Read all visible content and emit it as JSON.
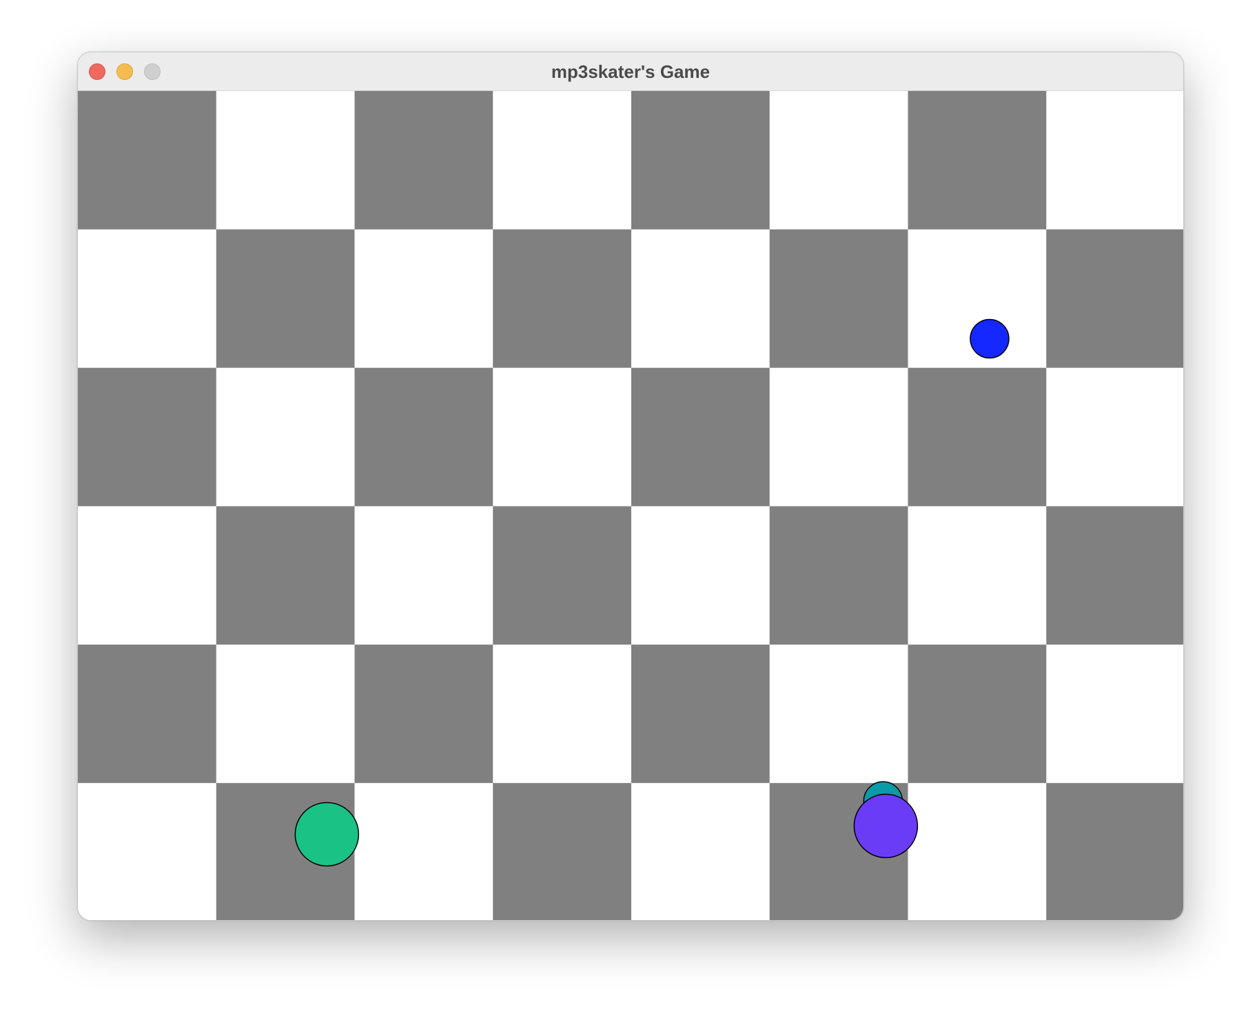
{
  "window": {
    "title": "mp3skater's Game"
  },
  "colors": {
    "dark_square": "#808080",
    "light_square": "#ffffff",
    "piece_outline": "#000000"
  },
  "board": {
    "rows": 6,
    "columns": 8,
    "top_left_square": "dark"
  },
  "pieces": [
    {
      "name": "blue-ball",
      "color": "#1428ff",
      "row": 1,
      "col": 6,
      "dx": 0.59,
      "dy": 0.79,
      "size": "small"
    },
    {
      "name": "green-ball",
      "color": "#1bc286",
      "row": 5,
      "col": 1,
      "dx": 0.8,
      "dy": 0.37,
      "size": "large"
    },
    {
      "name": "teal-ball",
      "color": "#0b9aa6",
      "row": 5,
      "col": 5,
      "dx": 0.82,
      "dy": 0.13,
      "size": "small"
    },
    {
      "name": "purple-ball",
      "color": "#6b3cf5",
      "row": 5,
      "col": 5,
      "dx": 0.84,
      "dy": 0.31,
      "size": "large"
    }
  ]
}
